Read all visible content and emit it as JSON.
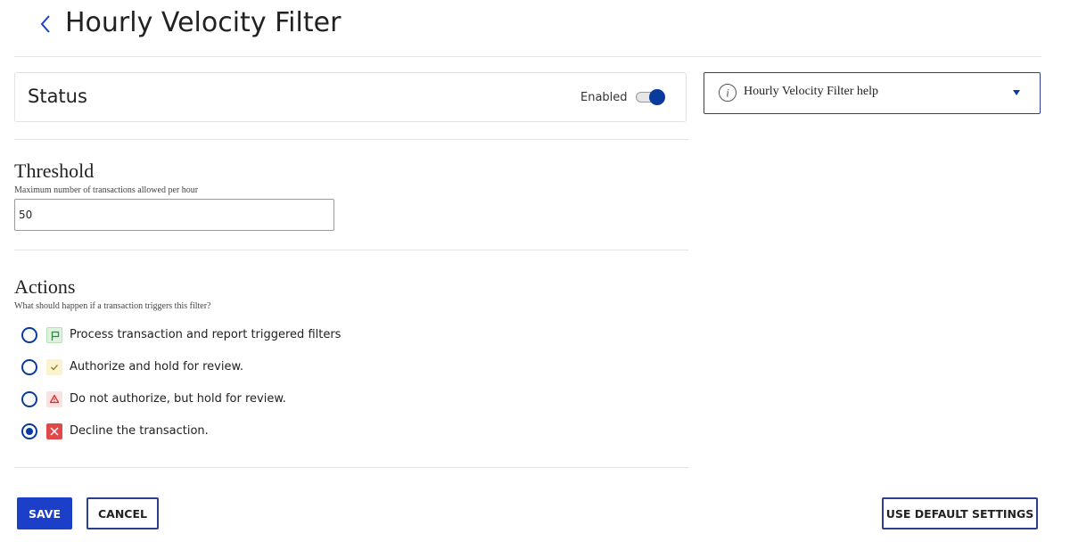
{
  "header": {
    "title": "Hourly Velocity Filter",
    "back_icon": "chevron-left-icon"
  },
  "status": {
    "title": "Status",
    "toggle_label": "Enabled",
    "enabled": true
  },
  "help": {
    "label": "Hourly Velocity Filter help",
    "icon": "info-icon"
  },
  "threshold": {
    "title": "Threshold",
    "description": "Maximum number of transactions allowed per hour",
    "value": "50"
  },
  "actions": {
    "title": "Actions",
    "description": "What should happen if a transaction triggers this filter?",
    "options": [
      {
        "label": "Process transaction and report triggered filters",
        "icon": "flag-icon",
        "selected": false
      },
      {
        "label": "Authorize and hold for review.",
        "icon": "check-icon",
        "selected": false
      },
      {
        "label": "Do not authorize, but hold for review.",
        "icon": "warning-icon",
        "selected": false
      },
      {
        "label": "Decline the transaction.",
        "icon": "x-icon",
        "selected": true
      }
    ]
  },
  "footer": {
    "save_label": "SAVE",
    "cancel_label": "CANCEL",
    "default_label": "USE DEFAULT SETTINGS"
  },
  "colors": {
    "primary": "#1b3fc8",
    "toggle_on": "#0b3a9e",
    "decline": "#e24848"
  }
}
